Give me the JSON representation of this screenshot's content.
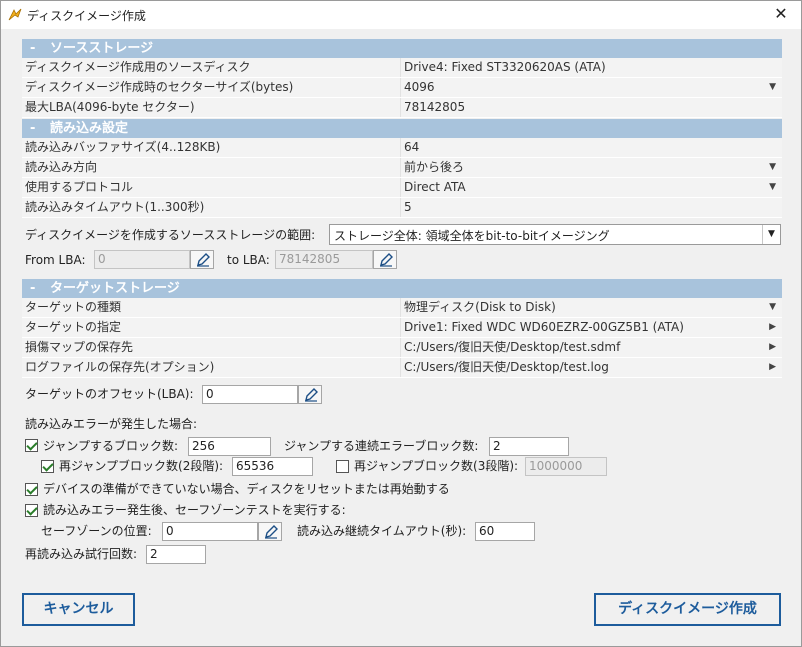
{
  "window": {
    "title": "ディスクイメージ作成",
    "close_glyph": "✕"
  },
  "source_section": {
    "header": "ソースストレージ",
    "rows": [
      {
        "key": "ディスクイメージ作成用のソースディスク",
        "value": "Drive4: Fixed ST3320620AS (ATA)",
        "arrow": ""
      },
      {
        "key": "ディスクイメージ作成時のセクターサイズ(bytes)",
        "value": "4096",
        "arrow": "▼"
      },
      {
        "key": "最大LBA(4096-byte セクター)",
        "value": "78142805",
        "arrow": ""
      }
    ]
  },
  "read_section": {
    "header": "読み込み設定",
    "rows": [
      {
        "key": "読み込みバッファサイズ(4..128KB)",
        "value": "64",
        "arrow": ""
      },
      {
        "key": "読み込み方向",
        "value": "前から後ろ",
        "arrow": "▼"
      },
      {
        "key": "使用するプロトコル",
        "value": "Direct ATA",
        "arrow": "▼"
      },
      {
        "key": "読み込みタイムアウト(1..300秒)",
        "value": "5",
        "arrow": ""
      }
    ]
  },
  "range": {
    "label": "ディスクイメージを作成するソースストレージの範囲:",
    "selected": "ストレージ全体: 領域全体をbit-to-bitイメージング",
    "from_label": "From LBA:",
    "from_value": "0",
    "to_label": "to LBA:",
    "to_value": "78142805"
  },
  "target_section": {
    "header": "ターゲットストレージ",
    "rows": [
      {
        "key": "ターゲットの種類",
        "value": "物理ディスク(Disk to Disk)",
        "arrow": "▼"
      },
      {
        "key": "ターゲットの指定",
        "value": "Drive1: Fixed WDC WD60EZRZ-00GZ5B1 (ATA)",
        "arrow": "▶"
      },
      {
        "key": "損傷マップの保存先",
        "value": "C:/Users/復旧天使/Desktop/test.sdmf",
        "arrow": "▶"
      },
      {
        "key": "ログファイルの保存先(オプション)",
        "value": "C:/Users/復旧天使/Desktop/test.log",
        "arrow": "▶"
      }
    ]
  },
  "offset": {
    "label": "ターゲットのオフセット(LBA):",
    "value": "0"
  },
  "errors": {
    "heading": "読み込みエラーが発生した場合:",
    "jump_label": "ジャンプするブロック数:",
    "jump_value": "256",
    "consecutive_label": "ジャンプする連続エラーブロック数:",
    "consecutive_value": "2",
    "rejump2_label": "再ジャンプブロック数(2段階):",
    "rejump2_value": "65536",
    "rejump3_label": "再ジャンプブロック数(3段階):",
    "rejump3_value": "1000000",
    "device_reset_label": "デバイスの準備ができていない場合、ディスクをリセットまたは再始動する",
    "safezone_label": "読み込みエラー発生後、セーフゾーンテストを実行する:",
    "safezone_pos_label": "セーフゾーンの位置:",
    "safezone_pos_value": "0",
    "continue_timeout_label": "読み込み継続タイムアウト(秒):",
    "continue_timeout_value": "60",
    "retry_label": "再読み込み試行回数:",
    "retry_value": "2"
  },
  "checkboxes": {
    "jump": true,
    "rejump2": true,
    "rejump3": false,
    "device_reset": true,
    "safezone": true
  },
  "buttons": {
    "cancel": "キャンセル",
    "create": "ディスクイメージ作成"
  },
  "colors": {
    "section_header": "#a8c3dc",
    "button_accent": "#1d5c9c"
  }
}
